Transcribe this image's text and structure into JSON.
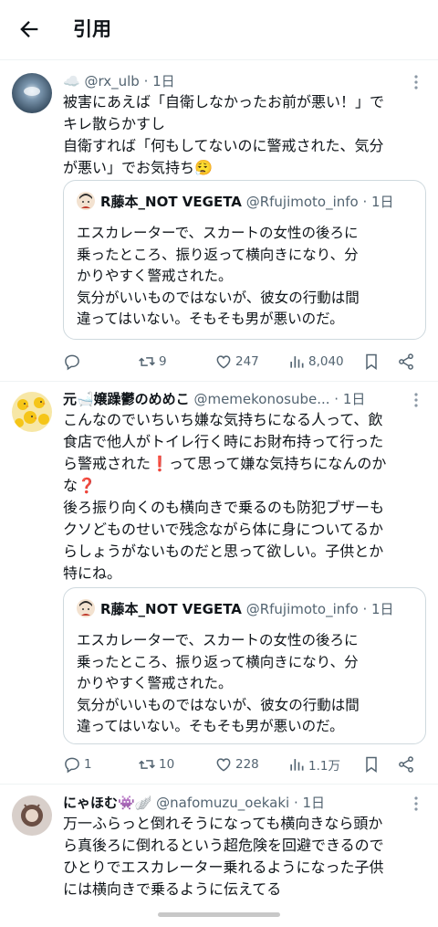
{
  "header": {
    "title": "引用"
  },
  "posts": [
    {
      "author": "☁️",
      "handle": "@rx_ulb · 1日",
      "body": [
        "被害にあえば「自衛しなかったお前が悪い！」で",
        "キレ散らかすし",
        "自衛すれば「何もしてないのに警戒された、気分",
        "が悪い」でお気持ち😮‍💨"
      ],
      "quote": {
        "author": "R藤本_NOT VEGETA",
        "handle": "@Rfujimoto_info · 1日",
        "body": [
          "エスカレーターで、スカートの女性の後ろに",
          "乗ったところ、振り返って横向きになり、分",
          "かりやすく警戒された。",
          "気分がいいものではないが、彼女の行動は間",
          "違ってはいない。そもそも男が悪いのだ。"
        ]
      },
      "replies": "",
      "reposts": "9",
      "likes": "247",
      "views": "8,040"
    },
    {
      "author": "元🛁嬢躁鬱のめめこ",
      "handle": "@memekonosube... · 1日",
      "body": [
        "こんなのでいちいち嫌な気持ちになる人って、飲",
        "食店で他人がトイレ行く時にお財布持って行った",
        "ら警戒された❗️って思って嫌な気持ちになんのか",
        "な❓",
        "後ろ振り向くのも横向きで乗るのも防犯ブザーも",
        "クソどものせいで残念ながら体に身についてるか",
        "らしょうがないものだと思って欲しい。子供とか",
        "特にね。"
      ],
      "quote": {
        "author": "R藤本_NOT VEGETA",
        "handle": "@Rfujimoto_info · 1日",
        "body": [
          "エスカレーターで、スカートの女性の後ろに",
          "乗ったところ、振り返って横向きになり、分",
          "かりやすく警戒された。",
          "気分がいいものではないが、彼女の行動は間",
          "違ってはいない。そもそも男が悪いのだ。"
        ]
      },
      "replies": "1",
      "reposts": "10",
      "likes": "228",
      "views": "1.1万"
    },
    {
      "author": "にゃほむ👾🪽",
      "handle": "@nafomuzu_oekaki · 1日",
      "body": [
        "万一ふらっと倒れそうになっても横向きなら頭か",
        "ら真後ろに倒れるという超危険を回避できるので",
        "ひとりでエスカレーター乗れるようになった子供",
        "には横向きで乗るように伝えてる"
      ]
    }
  ],
  "colors": {
    "text": "#0f1419",
    "secondary": "#536471",
    "border": "#cfd9de",
    "divider": "#eff3f4"
  },
  "icons": [
    "back-arrow-icon",
    "more-icon",
    "reply-icon",
    "repost-icon",
    "like-icon",
    "views-icon",
    "bookmark-icon",
    "share-icon"
  ]
}
